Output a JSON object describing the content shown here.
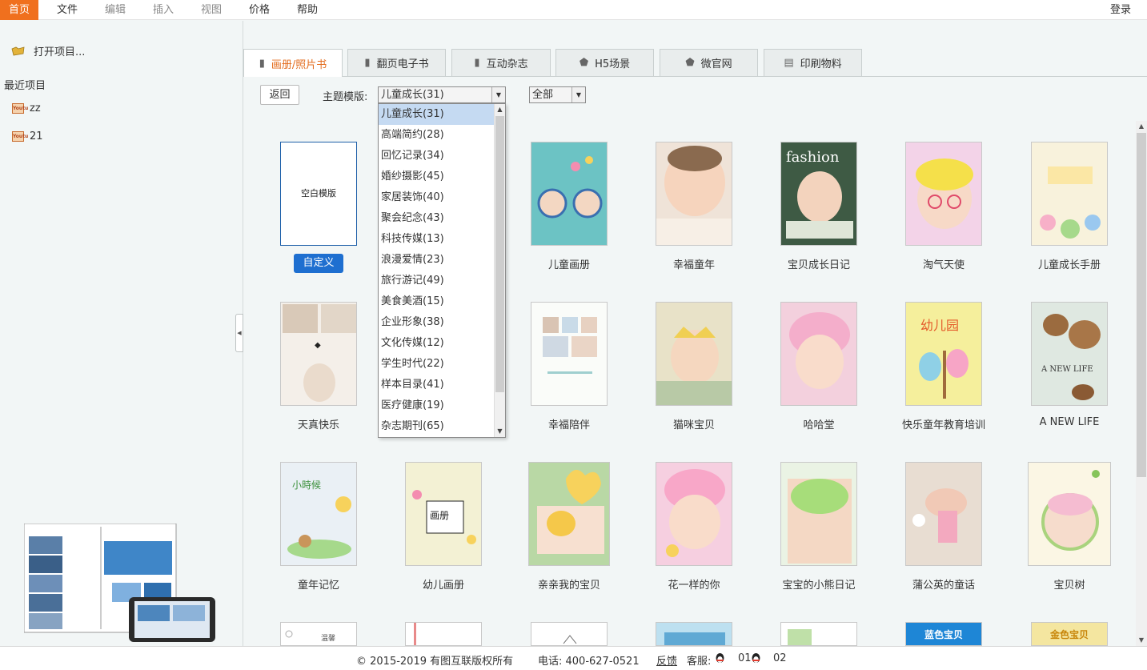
{
  "menubar": {
    "items": [
      "首页",
      "文件",
      "编辑",
      "插入",
      "视图",
      "价格",
      "帮助"
    ],
    "login": "登录"
  },
  "sidebar": {
    "open_project": "打开项目...",
    "recent_title": "最近项目",
    "recent": [
      "zz",
      "21"
    ],
    "file_icon_text": "Youtu"
  },
  "tabs": [
    "画册/照片书",
    "翻页电子书",
    "互动杂志",
    "H5场景",
    "微官网",
    "印刷物料"
  ],
  "filter": {
    "back": "返回",
    "theme_label": "主题模版:",
    "theme_selected": "儿童成长(31)",
    "scope_selected": "全部"
  },
  "dropdown": {
    "options": [
      "儿童成长(31)",
      "高端简约(28)",
      "回忆记录(34)",
      "婚纱摄影(45)",
      "家居装饰(40)",
      "聚会纪念(43)",
      "科技传媒(13)",
      "浪漫爱情(23)",
      "旅行游记(49)",
      "美食美酒(15)",
      "企业形象(38)",
      "文化传媒(12)",
      "学生时代(22)",
      "样本目录(41)",
      "医疗健康(19)",
      "杂志期刊(65)"
    ]
  },
  "blank": {
    "label": "空白模版",
    "custom_button": "自定义"
  },
  "templates": {
    "row1": [
      "儿童画册",
      "幸福童年",
      "宝贝成长日记",
      "淘气天使",
      "儿童成长手册"
    ],
    "row2_first": "天真快乐",
    "row2": [
      "幸福陪伴",
      "猫咪宝贝",
      "哈哈堂",
      "快乐童年教育培训",
      "A NEW LIFE"
    ],
    "row3": [
      "童年记忆",
      "幼儿画册",
      "亲亲我的宝贝",
      "花一样的你",
      "宝宝的小熊日记",
      "蒲公英的童话",
      "宝贝树"
    ],
    "row4_labels": [
      "蓝色宝贝",
      "金色宝贝"
    ]
  },
  "footer": {
    "copyright": "© 2015-2019 有图互联版权所有",
    "phone": "电话: 400-627-0521",
    "feedback": "反馈",
    "service": "客服:",
    "qq1": "01",
    "qq2": "02"
  },
  "colors": {
    "accent": "#f0701e",
    "primary_button": "#1e6fd0",
    "dropdown_selected": "#c5daf2"
  }
}
